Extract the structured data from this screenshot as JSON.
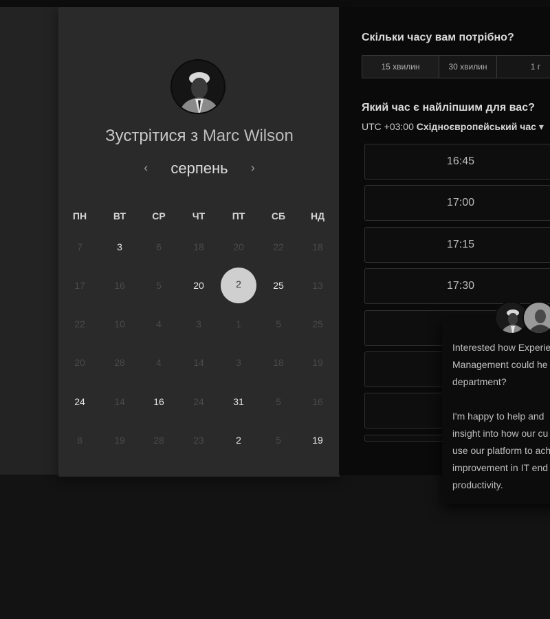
{
  "booking": {
    "title_prefix": "Зустрітися з",
    "host_name": "Marc Wilson",
    "month_label": "серпень",
    "prev_arrow": "‹",
    "next_arrow": "›",
    "weekdays": [
      "ПН",
      "ВТ",
      "СР",
      "ЧТ",
      "ПТ",
      "СБ",
      "НД"
    ],
    "weeks": [
      [
        {
          "d": "7",
          "state": "off"
        },
        {
          "d": "3",
          "state": "on"
        },
        {
          "d": "6",
          "state": "off"
        },
        {
          "d": "18",
          "state": "off"
        },
        {
          "d": "20",
          "state": "off"
        },
        {
          "d": "22",
          "state": "off"
        },
        {
          "d": "18",
          "state": "off"
        }
      ],
      [
        {
          "d": "17",
          "state": "off"
        },
        {
          "d": "16",
          "state": "off"
        },
        {
          "d": "5",
          "state": "off"
        },
        {
          "d": "20",
          "state": "on"
        },
        {
          "d": "2",
          "state": "selected"
        },
        {
          "d": "25",
          "state": "on"
        },
        {
          "d": "13",
          "state": "off"
        }
      ],
      [
        {
          "d": "22",
          "state": "off"
        },
        {
          "d": "10",
          "state": "off"
        },
        {
          "d": "4",
          "state": "off"
        },
        {
          "d": "3",
          "state": "off"
        },
        {
          "d": "1",
          "state": "off"
        },
        {
          "d": "5",
          "state": "off"
        },
        {
          "d": "25",
          "state": "off"
        }
      ],
      [
        {
          "d": "20",
          "state": "off"
        },
        {
          "d": "28",
          "state": "off"
        },
        {
          "d": "4",
          "state": "off"
        },
        {
          "d": "14",
          "state": "off"
        },
        {
          "d": "3",
          "state": "off"
        },
        {
          "d": "18",
          "state": "off"
        },
        {
          "d": "19",
          "state": "off"
        }
      ],
      [
        {
          "d": "24",
          "state": "on"
        },
        {
          "d": "14",
          "state": "off"
        },
        {
          "d": "16",
          "state": "on"
        },
        {
          "d": "24",
          "state": "off"
        },
        {
          "d": "31",
          "state": "on"
        },
        {
          "d": "5",
          "state": "off"
        },
        {
          "d": "16",
          "state": "off"
        }
      ],
      [
        {
          "d": "8",
          "state": "off"
        },
        {
          "d": "19",
          "state": "off"
        },
        {
          "d": "28",
          "state": "off"
        },
        {
          "d": "23",
          "state": "off"
        },
        {
          "d": "2",
          "state": "on"
        },
        {
          "d": "5",
          "state": "off"
        },
        {
          "d": "19",
          "state": "on"
        }
      ]
    ]
  },
  "duration": {
    "question": "Скільки часу вам потрібно?",
    "options": [
      "15 хвилин",
      "30 хвилин",
      "1 г"
    ]
  },
  "time": {
    "question": "Який час є найліпшим для вас?",
    "tz_offset": "UTC +03:00",
    "tz_name": "Східноєвропейський час",
    "tz_caret": "▾",
    "slots": [
      "16:45",
      "17:00",
      "17:15",
      "17:30",
      "",
      "",
      "",
      ""
    ]
  },
  "chat": {
    "lines_p1": [
      "Interested how Experie",
      "Management could he",
      "department?"
    ],
    "lines_p2": [
      "I'm happy to help and",
      "insight into how our cu",
      "use our platform to ach",
      "improvement in IT end",
      "productivity."
    ]
  }
}
